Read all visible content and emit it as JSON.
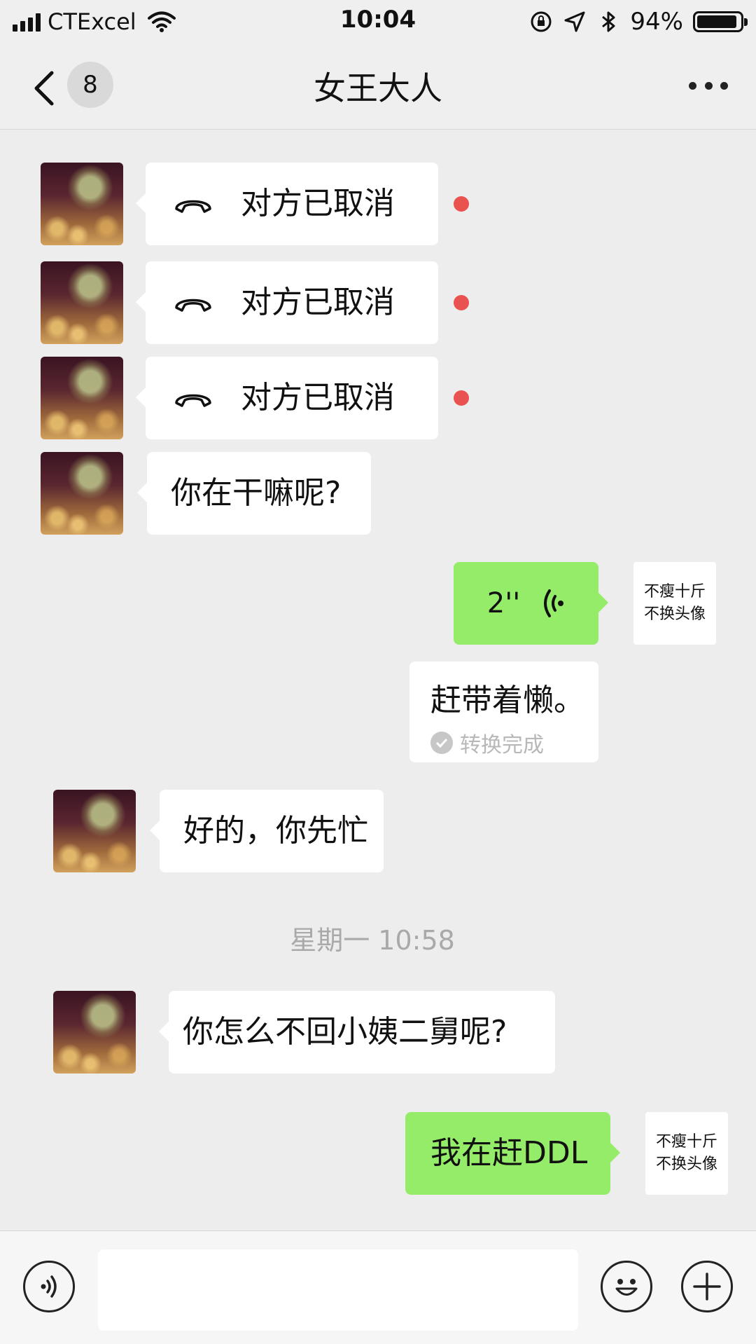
{
  "status_bar": {
    "carrier": "CTExcel",
    "time": "10:04",
    "battery_text": "94%",
    "battery_level": 0.94
  },
  "nav": {
    "unread_count": "8",
    "title": "女王大人"
  },
  "messages": {
    "call1": "对方已取消",
    "call2": "对方已取消",
    "call3": "对方已取消",
    "text1": "你在干嘛呢?",
    "voice_duration": "2''",
    "transcript": "赶带着懒。",
    "transcript_status": "转换完成",
    "text2": "好的，你先忙",
    "timestamp": "星期一 10:58",
    "text3": "你怎么不回小姨二舅呢?",
    "text4": "我在赶DDL"
  },
  "self_avatar": {
    "line1": "不瘦十斤",
    "line2": "不换头像"
  },
  "colors": {
    "sent_bubble": "#95ec69",
    "unread_dot": "#e9524f",
    "background": "#ededed"
  },
  "input": {
    "value": ""
  }
}
